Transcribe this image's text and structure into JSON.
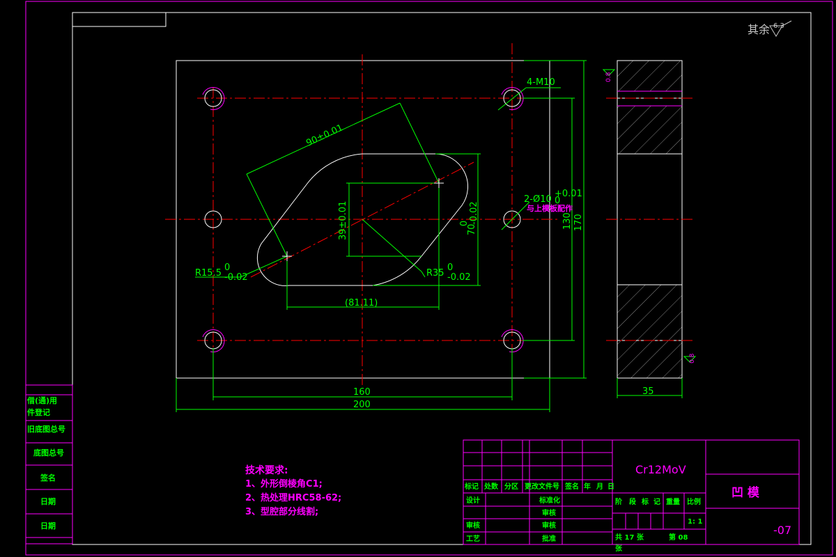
{
  "surface_finish": {
    "label": "其余",
    "value": "6.3"
  },
  "front_view": {
    "hole_callout": "4-M10",
    "dim_diag": "90±0.01",
    "dim_39": "39±0.01",
    "dim_70": "70",
    "dim_70_tol_upper": "0",
    "dim_70_tol_lower": "-0.02",
    "dim_130": "130",
    "dim_170": "170",
    "dim_160": "160",
    "dim_200": "200",
    "dim_8111": "(81.11)",
    "radius_small": "R15.5",
    "radius_small_tol_upper": "0",
    "radius_small_tol_lower": "-0.02",
    "radius_large": "R35",
    "radius_large_tol_upper": "0",
    "radius_large_tol_lower": "-0.02",
    "pin_hole_callout": "2-Ø10",
    "pin_hole_tol_upper": "+0.01",
    "pin_hole_tol_lower": "0",
    "pin_hole_note": "与上模板配作"
  },
  "side_view": {
    "dim_35": "35",
    "roughness_top": "0.8",
    "roughness_bottom": "0.8"
  },
  "tech_requirements": {
    "title": "技术要求:",
    "items": [
      "1、外形倒棱角C1;",
      "2、热处理HRC58-62;",
      "3、型腔部分线割;"
    ]
  },
  "left_column": [
    "借(通)用",
    "件登记",
    "旧底图总号",
    "底图总号",
    "签名",
    "日期",
    "日期"
  ],
  "title_block": {
    "material": "Cr12MoV",
    "part_name": "凹  模",
    "drawing_no": "-07",
    "header_row": [
      "标记",
      "处数",
      "分区",
      "更改文件号",
      "签名",
      "年",
      "月",
      "日"
    ],
    "design": "设计",
    "review": "审核",
    "process": "工艺",
    "standardization": "标准化",
    "approve_check": "审核",
    "approve": "批准",
    "stage_cols": [
      "阶",
      "段",
      "标",
      "记",
      "重量",
      "比例"
    ],
    "scale": "1: 1",
    "sheet_total": "共 17  张",
    "sheet_no": "第 08",
    "sheet_unit": "张"
  },
  "colors": {
    "frame": "#ff00ff",
    "dimension": "#00ff00",
    "center_line": "#ff0000",
    "outline": "#ffffff",
    "annotation": "#ff00ff"
  }
}
